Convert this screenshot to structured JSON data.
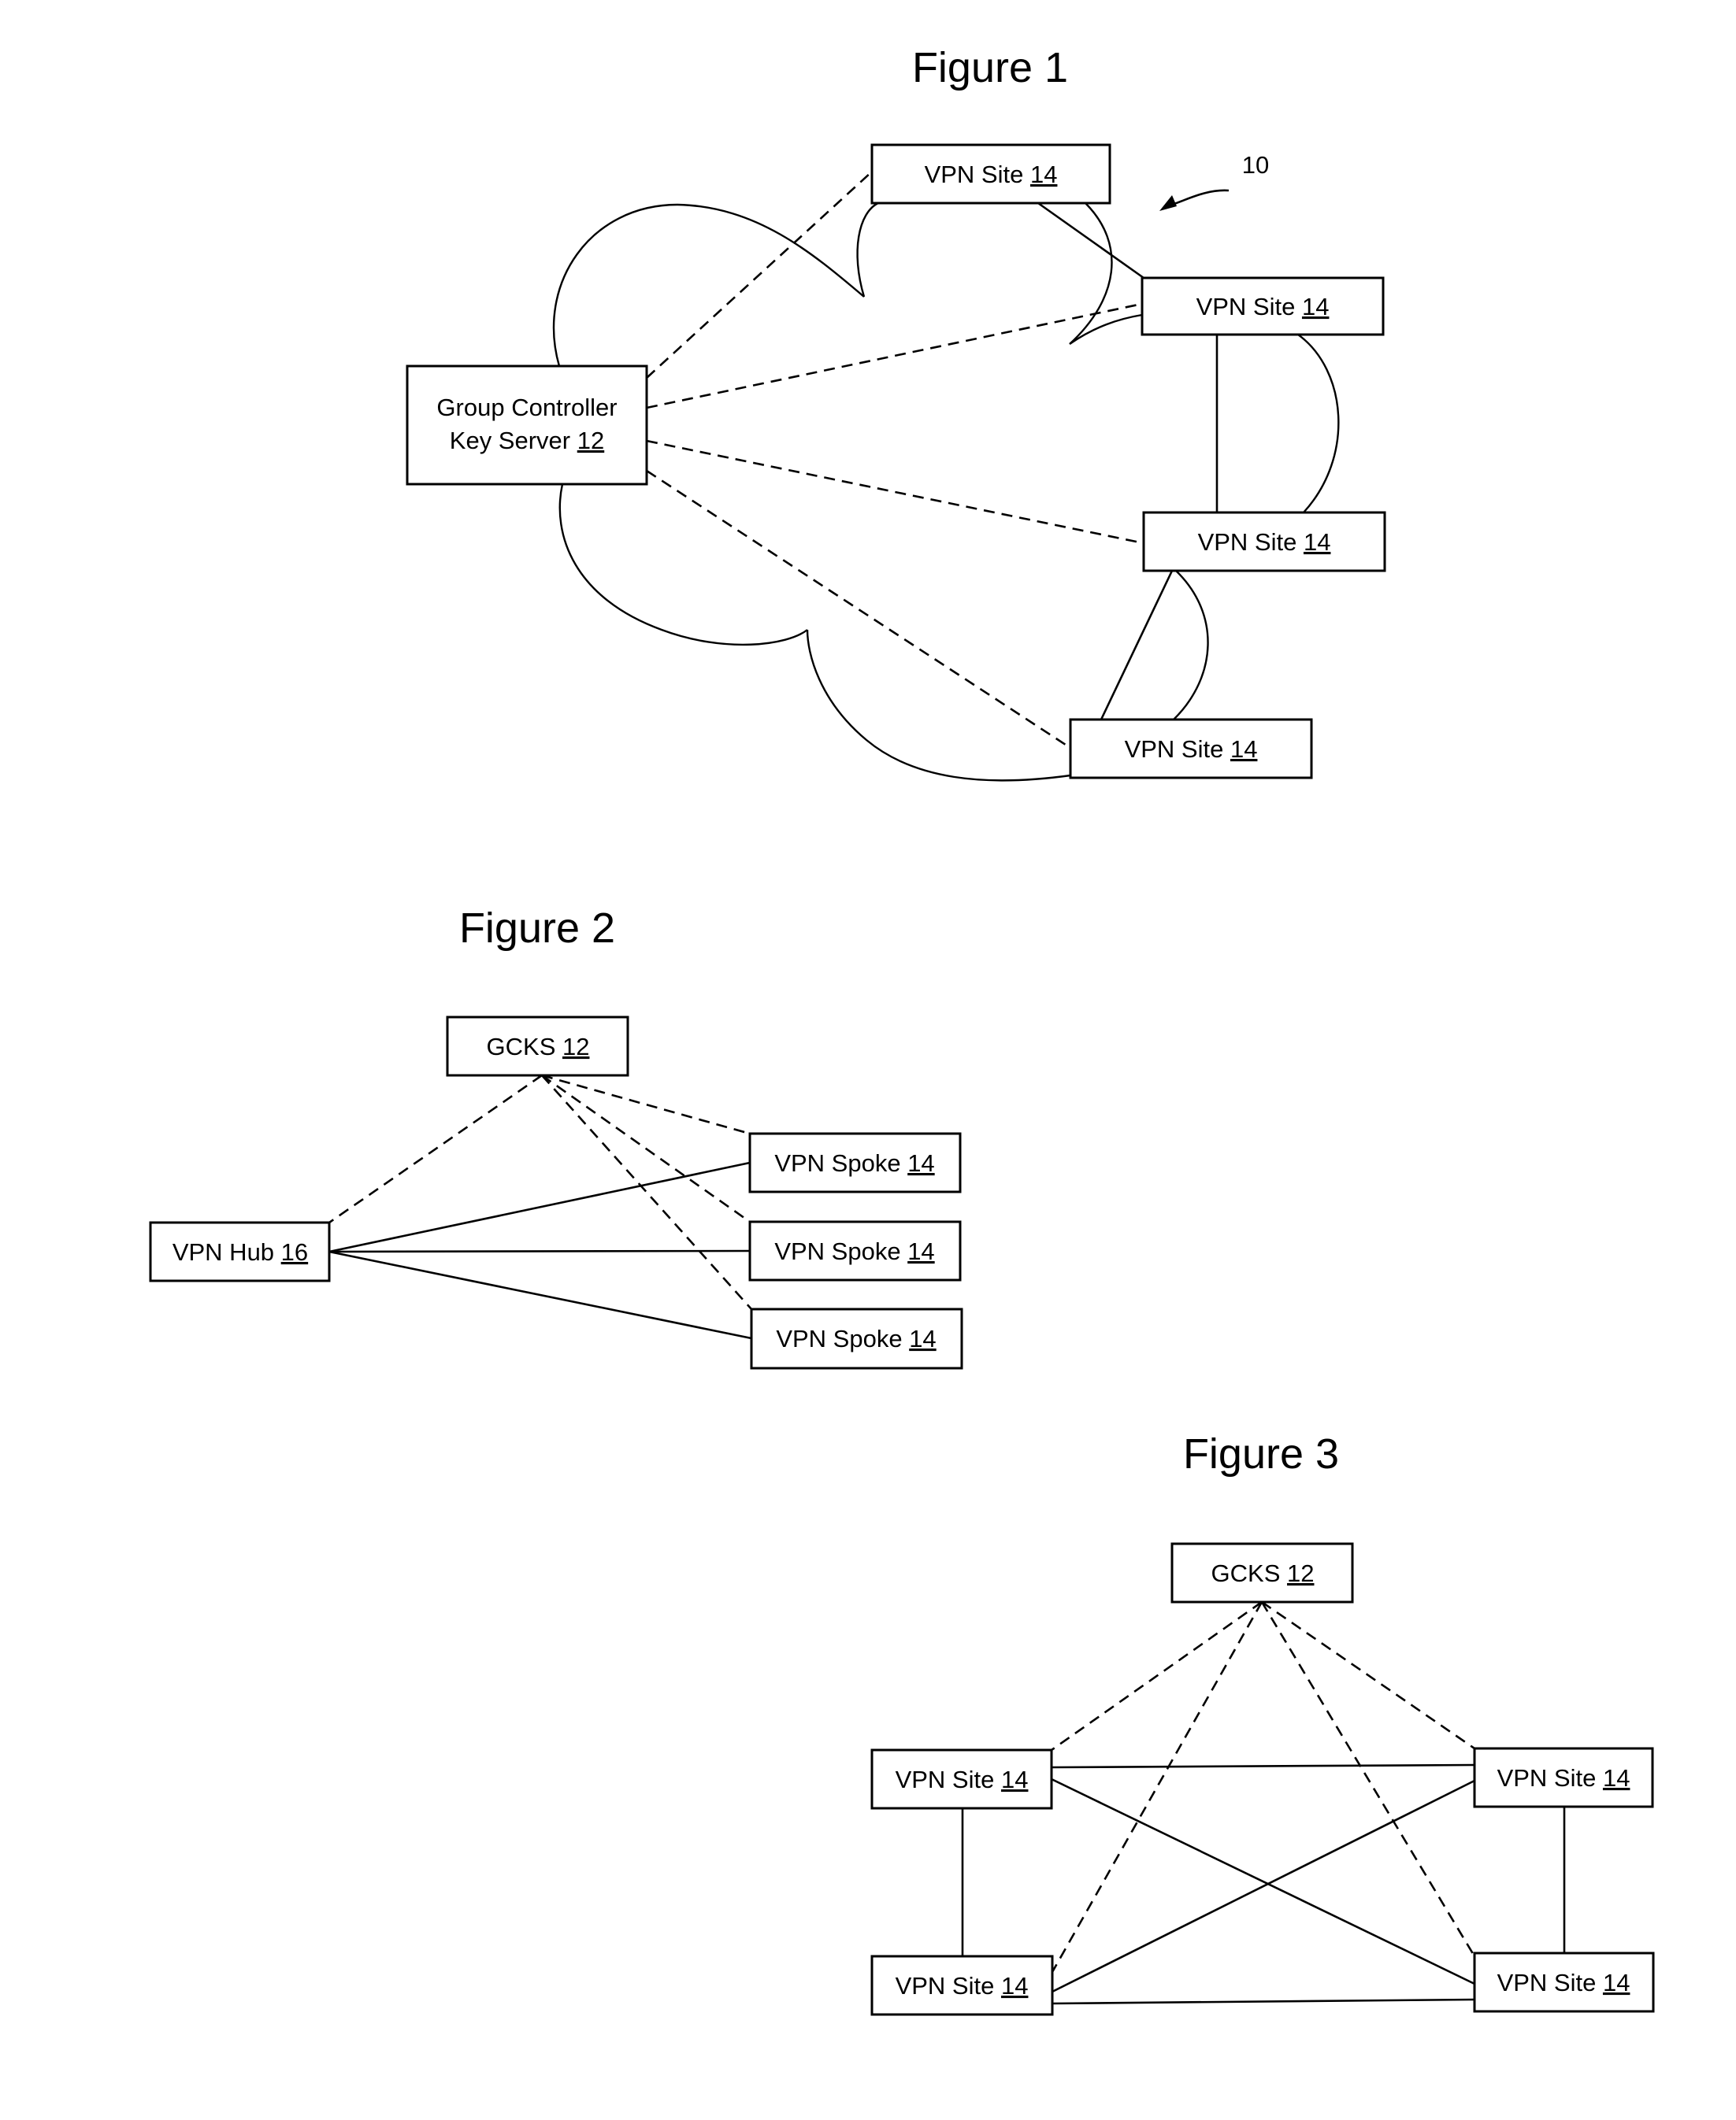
{
  "figure1": {
    "title": "Figure 1",
    "ref_label": "10",
    "server": {
      "line1": "Group Controller",
      "line2": "Key Server ",
      "ref": "12"
    },
    "sites": [
      {
        "name": "VPN Site ",
        "ref": "14"
      },
      {
        "name": "VPN Site ",
        "ref": "14"
      },
      {
        "name": "VPN Site ",
        "ref": "14"
      },
      {
        "name": "VPN Site ",
        "ref": "14"
      }
    ]
  },
  "figure2": {
    "title": "Figure 2",
    "gcks": {
      "name": "GCKS ",
      "ref": "12"
    },
    "hub": {
      "name": "VPN Hub ",
      "ref": "16"
    },
    "spokes": [
      {
        "name": "VPN Spoke ",
        "ref": "14"
      },
      {
        "name": "VPN Spoke ",
        "ref": "14"
      },
      {
        "name": "VPN Spoke ",
        "ref": "14"
      }
    ]
  },
  "figure3": {
    "title": "Figure 3",
    "gcks": {
      "name": "GCKS ",
      "ref": "12"
    },
    "sites": [
      {
        "name": "VPN Site ",
        "ref": "14"
      },
      {
        "name": "VPN Site ",
        "ref": "14"
      },
      {
        "name": "VPN Site ",
        "ref": "14"
      },
      {
        "name": "VPN Site ",
        "ref": "14"
      }
    ]
  }
}
